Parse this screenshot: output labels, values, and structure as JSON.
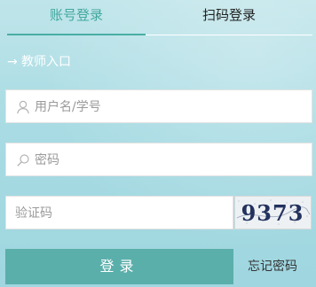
{
  "tabs": {
    "account": "账号登录",
    "qrcode": "扫码登录"
  },
  "entry": {
    "arrow": "→",
    "label": "教师入口"
  },
  "form": {
    "username_placeholder": "用户名/学号",
    "password_placeholder": "密码",
    "captcha_placeholder": "验证码",
    "captcha_text": "9373",
    "login_label": "登录",
    "forgot_label": "忘记密码"
  },
  "colors": {
    "accent": "#42a89f",
    "button": "#5aafab",
    "background": "#a8dbe3"
  },
  "icons": {
    "username": "user-icon",
    "password": "search-icon"
  }
}
